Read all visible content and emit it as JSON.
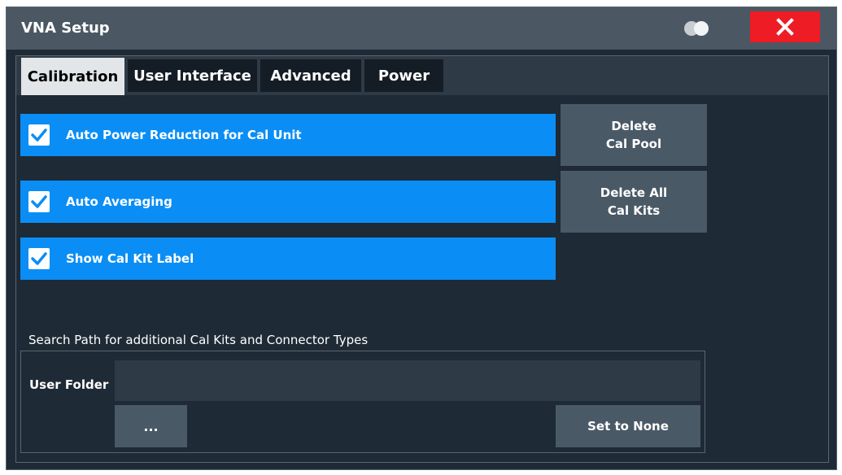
{
  "window": {
    "title": "VNA Setup"
  },
  "tabs": [
    {
      "label": "Calibration",
      "active": true
    },
    {
      "label": "User Interface",
      "active": false
    },
    {
      "label": "Advanced",
      "active": false
    },
    {
      "label": "Power",
      "active": false
    }
  ],
  "options": [
    {
      "label": "Auto Power Reduction for Cal Unit",
      "checked": true
    },
    {
      "label": "Auto Averaging",
      "checked": true
    },
    {
      "label": "Show Cal Kit Label",
      "checked": true
    }
  ],
  "buttons": {
    "delete_cal_pool": [
      "Delete",
      "Cal Pool"
    ],
    "delete_all_cal_kits": [
      "Delete All",
      "Cal Kits"
    ]
  },
  "search_path": {
    "label": "Search Path for additional Cal Kits and Connector Types",
    "user_folder_label": "User Folder",
    "user_folder_value": "",
    "browse_label": "...",
    "set_none_label": "Set to None"
  },
  "colors": {
    "accent": "#0a8ef5",
    "close": "#ee1c24",
    "background": "#1e2a35",
    "button": "#4a5966"
  },
  "icons": {
    "close": "close-icon",
    "toggle": "toggle-icon",
    "check": "checkmark-icon"
  }
}
